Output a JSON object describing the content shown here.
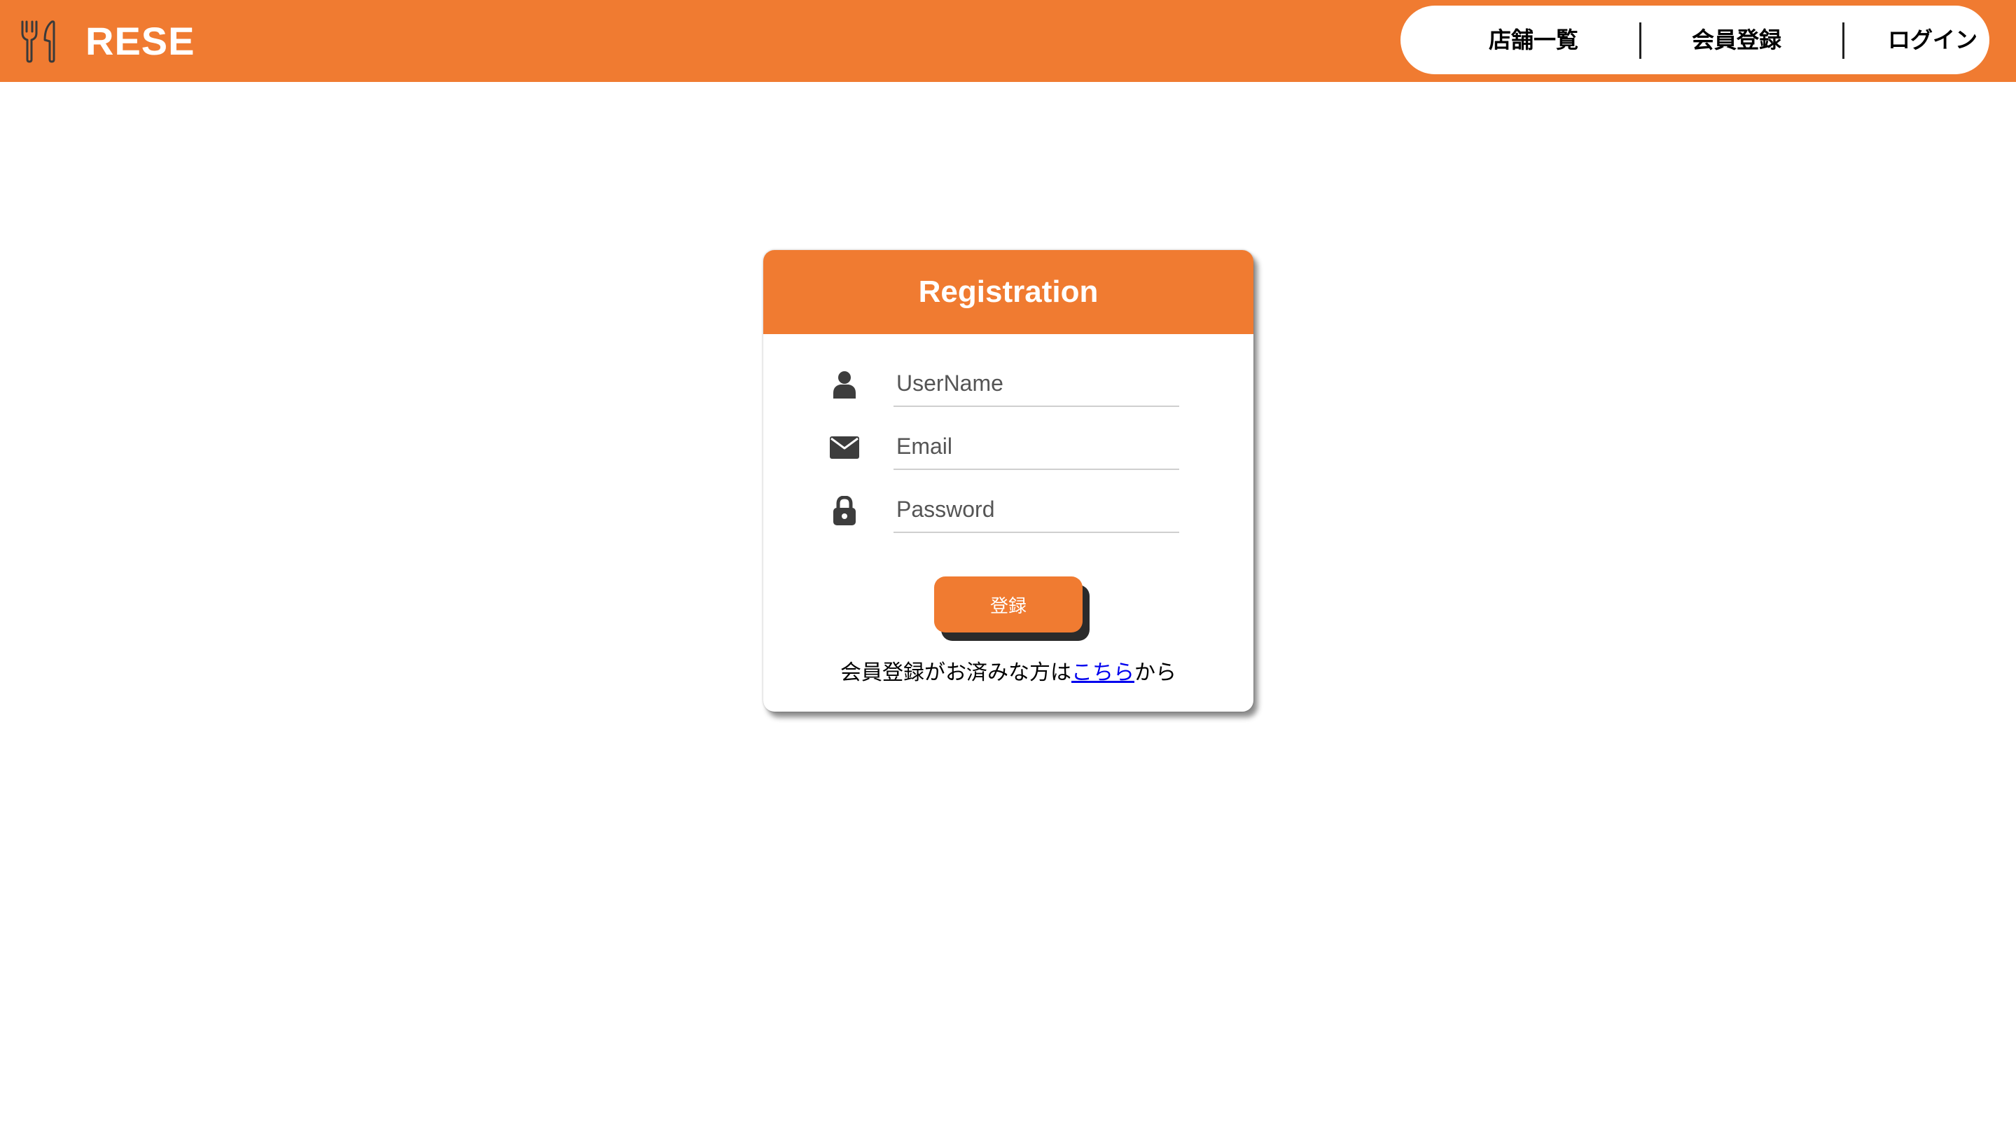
{
  "header": {
    "brand_icon": "fork-knife-icon",
    "brand_name": "RESE",
    "nav": [
      {
        "label": "店舗一覧"
      },
      {
        "label": "会員登録"
      },
      {
        "label": "ログイン"
      }
    ]
  },
  "form": {
    "title": "Registration",
    "fields": [
      {
        "icon": "user-icon",
        "placeholder": "UserName",
        "value": ""
      },
      {
        "icon": "envelope-icon",
        "placeholder": "Email",
        "value": ""
      },
      {
        "icon": "lock-icon",
        "placeholder": "Password",
        "value": ""
      }
    ],
    "submit_label": "登録",
    "login_prefix": "会員登録がお済みな方は",
    "login_link": "こちら",
    "login_suffix": "から"
  },
  "colors": {
    "accent": "#f07b31",
    "link": "#0000ee",
    "icon": "#3d3d3d"
  }
}
